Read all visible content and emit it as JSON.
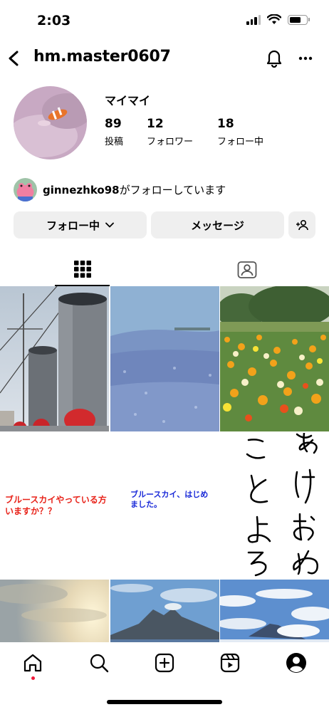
{
  "status_bar": {
    "time": "2:03"
  },
  "header": {
    "username": "hm.master0607"
  },
  "profile": {
    "display_name": "マイマイ",
    "stats": [
      {
        "value": "89",
        "label": "投稿"
      },
      {
        "value": "12",
        "label": "フォロワー"
      },
      {
        "value": "18",
        "label": "フォロー中"
      }
    ]
  },
  "followed_by": {
    "user": "ginnezhko98",
    "text": "がフォローしています"
  },
  "actions": {
    "follow_label": "フォロー中",
    "message_label": "メッセージ"
  },
  "grid": {
    "posts": [
      {
        "kind": "photo",
        "subject": "ship funnels"
      },
      {
        "kind": "photo",
        "subject": "blue flower hill"
      },
      {
        "kind": "photo",
        "subject": "poppy field"
      },
      {
        "kind": "text",
        "text": "ブルースカイやっている方いますか？？",
        "color": "#e8231a"
      },
      {
        "kind": "text",
        "text": "ブルースカイ、はじめました。",
        "color": "#1a2ad8"
      },
      {
        "kind": "handwriting",
        "text": "あけおめことよろ"
      },
      {
        "kind": "photo",
        "subject": "sunset sky"
      },
      {
        "kind": "photo",
        "subject": "volcano"
      },
      {
        "kind": "photo",
        "subject": "clouds and mountain"
      }
    ]
  },
  "nav": {
    "items": [
      {
        "icon": "home-icon"
      },
      {
        "icon": "search-icon"
      },
      {
        "icon": "create-icon"
      },
      {
        "icon": "reels-icon"
      },
      {
        "icon": "profile-icon"
      }
    ],
    "notification_color": "#f0193a"
  }
}
